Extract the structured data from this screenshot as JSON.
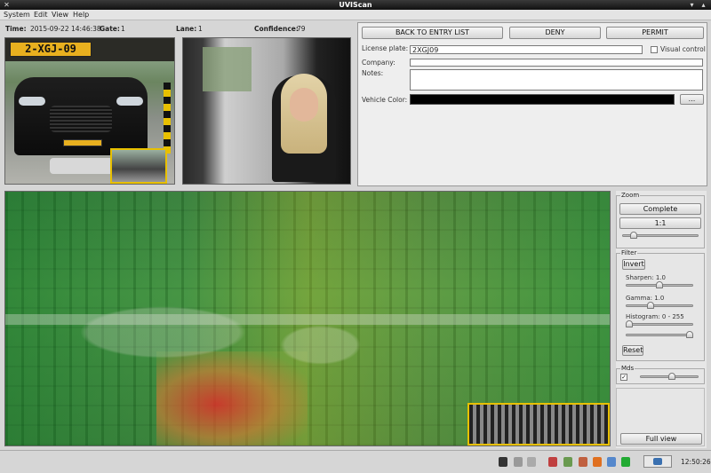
{
  "window": {
    "title": "UVIScan"
  },
  "menu": [
    "System",
    "Edit",
    "View",
    "Help"
  ],
  "info": {
    "time_label": "Time:",
    "time": "2015-09-22 14:46:38",
    "gate_label": "Gate:",
    "gate": "1",
    "lane_label": "Lane:",
    "lane": "1",
    "confidence_label": "Confidence:",
    "confidence": "79"
  },
  "photos": {
    "plate_text": "2-XGJ-09"
  },
  "actions": {
    "back": "BACK TO ENTRY LIST",
    "deny": "DENY",
    "permit": "PERMIT"
  },
  "form": {
    "license_label": "License plate:",
    "license_value": "2XGJ09",
    "visual_control": "Visual control",
    "company_label": "Company:",
    "company_value": "",
    "notes_label": "Notes:",
    "notes_value": "",
    "color_label": "Vehicle Color:",
    "color_value": "#000000",
    "color_button": "..."
  },
  "zoom": {
    "title": "Zoom",
    "complete": "Complete",
    "ratio": "1:1",
    "slider": 0.12
  },
  "filter": {
    "title": "Filter",
    "invert": "Invert",
    "sharpen_label": "Sharpen: 1.0",
    "sharpen": 0.5,
    "gamma_label": "Gamma: 1.0",
    "gamma": 0.35,
    "histogram_label": "Histogram: 0 - 255",
    "hist_low": 0.0,
    "hist_high": 1.0,
    "reset": "Reset"
  },
  "mds": {
    "title": "Mds",
    "checked": true,
    "slider": 0.55
  },
  "fullview": "Full view",
  "status": {
    "clock": "12:50:26"
  }
}
